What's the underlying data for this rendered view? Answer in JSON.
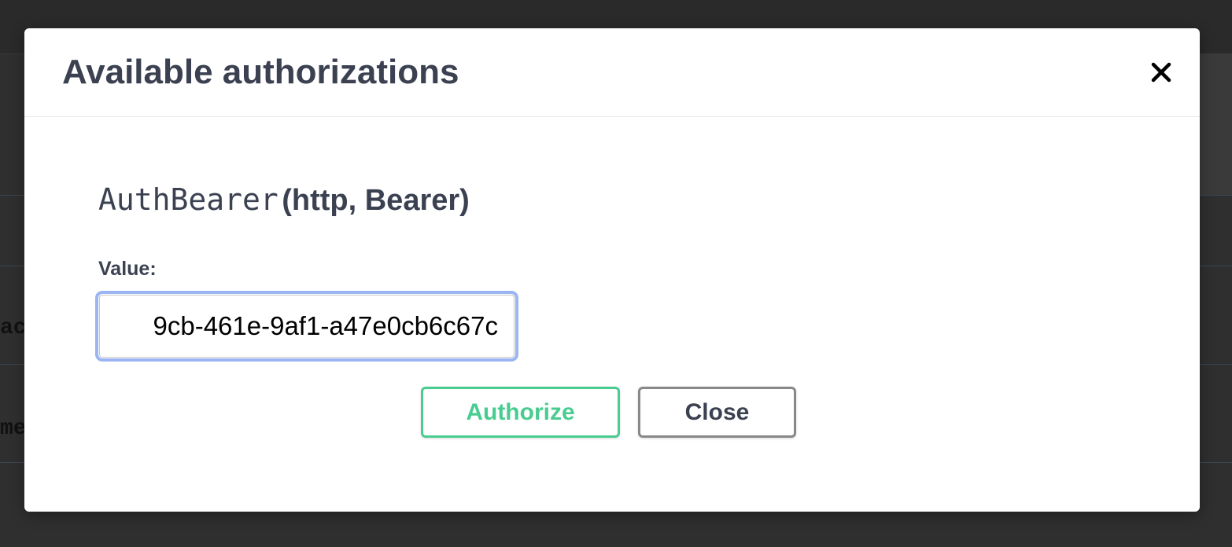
{
  "background": {
    "fragments": [
      "ac",
      "me"
    ]
  },
  "modal": {
    "title": "Available authorizations",
    "close_icon": "close-icon",
    "scheme": {
      "name": "AuthBearer",
      "type": "(http, Bearer)",
      "value_label": "Value:",
      "value": "9cb-461e-9af1-a47e0cb6c67c"
    },
    "buttons": {
      "authorize_label": "Authorize",
      "close_label": "Close"
    }
  },
  "colors": {
    "authorize": "#49cc90",
    "text": "#3b4151",
    "focus_ring": "#9bb4f2",
    "close_border": "#888888"
  }
}
